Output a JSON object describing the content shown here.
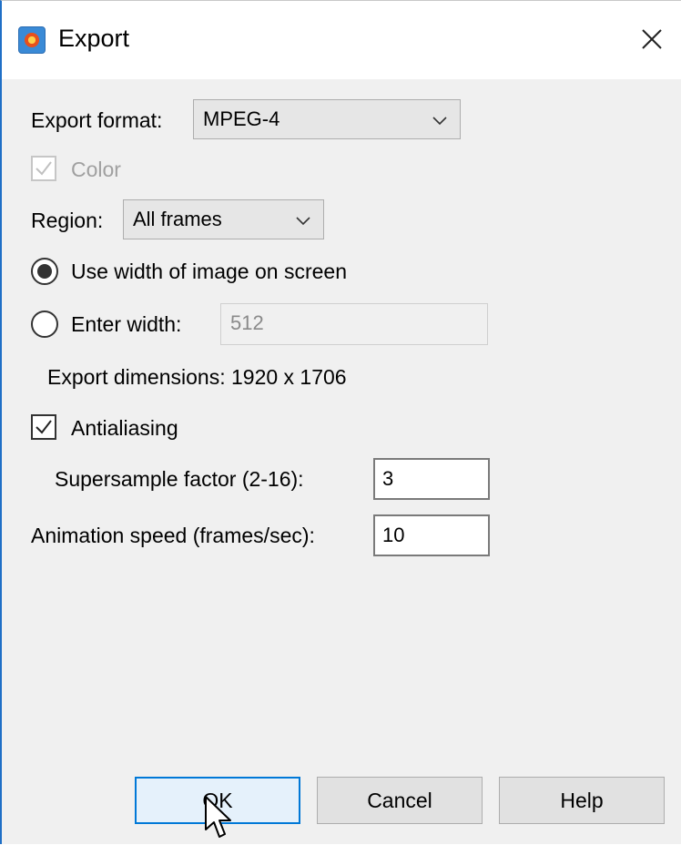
{
  "window": {
    "title": "Export"
  },
  "form": {
    "export_format_label": "Export format:",
    "export_format_value": "MPEG-4",
    "color_label": "Color",
    "color_checked": true,
    "region_label": "Region:",
    "region_value": "All frames",
    "use_width_label": "Use width of image on screen",
    "enter_width_label": "Enter width:",
    "enter_width_value": "512",
    "export_dimensions_label": "Export dimensions:  1920 x 1706",
    "antialiasing_label": "Antialiasing",
    "antialiasing_checked": true,
    "supersample_label": "Supersample factor (2-16):",
    "supersample_value": "3",
    "animation_speed_label": "Animation speed (frames/sec):",
    "animation_speed_value": "10"
  },
  "buttons": {
    "ok": "OK",
    "cancel": "Cancel",
    "help": "Help"
  },
  "icons": {
    "app": "app-logo-icon",
    "close": "close-icon",
    "dropdown": "chevron-down-icon",
    "check": "checkmark-icon",
    "cursor": "mouse-pointer-icon"
  }
}
